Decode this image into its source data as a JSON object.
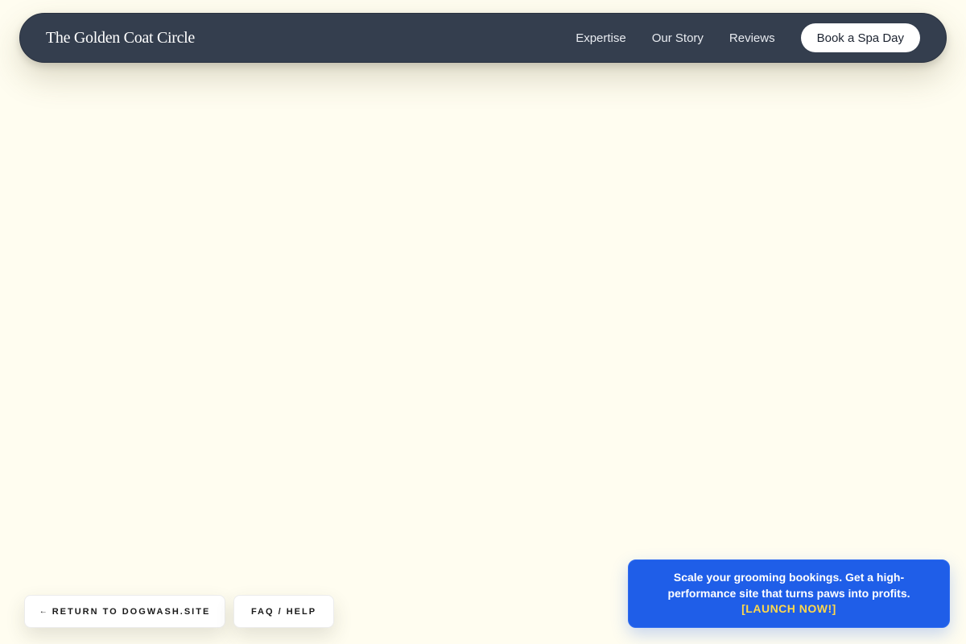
{
  "header": {
    "brand": "The Golden Coat Circle",
    "nav": [
      {
        "label": "Expertise"
      },
      {
        "label": "Our Story"
      },
      {
        "label": "Reviews"
      }
    ],
    "cta_label": "Book a Spa Day"
  },
  "footer_actions": {
    "return_arrow": "←",
    "return_label": "RETURN TO DOGWASH.SITE",
    "faq_label": "FAQ / HELP"
  },
  "promo": {
    "text": "Scale your grooming bookings. Get a high-performance site that turns paws into profits.",
    "link_label": "[LAUNCH NOW!]"
  },
  "colors": {
    "background": "#fffdf0",
    "navbar": "#343e4e",
    "promo": "#1f5ee8",
    "promo_link": "#ffd84a"
  }
}
